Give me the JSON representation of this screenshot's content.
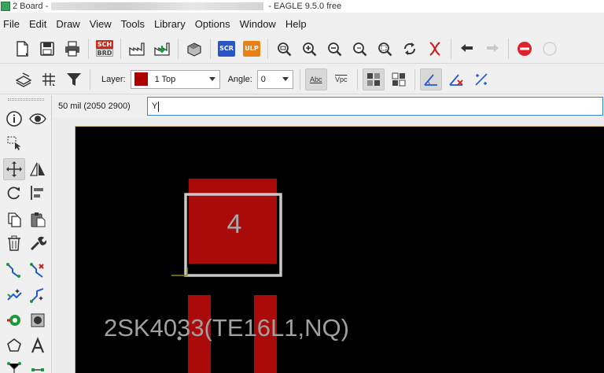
{
  "window": {
    "title_prefix": "2 Board - ",
    "title_suffix": "- EAGLE 9.5.0 free"
  },
  "menu": [
    "File",
    "Edit",
    "Draw",
    "View",
    "Tools",
    "Library",
    "Options",
    "Window",
    "Help"
  ],
  "toolbar1": {
    "sch_label": "SCH",
    "brd_label": "BRD",
    "scr_label": "SCR",
    "ulp_label": "ULP"
  },
  "toolbar2": {
    "layer_label": "Layer:",
    "layer_value": "1 Top",
    "layer_color": "#aa0000",
    "angle_label": "Angle:",
    "angle_value": "0",
    "abc_label": "Abc",
    "vpc_label": "Vpc"
  },
  "command": {
    "coordinates": "50 mil (2050 2900)",
    "input_value": "Y"
  },
  "canvas": {
    "pad_number": "4",
    "part_label": "2SK4033(TE16L1,NQ)",
    "pad_color": "#aa0a0a",
    "label_color": "#a0a0a0",
    "outline_color": "#c8c8c8",
    "board_edge_color": "#c9b06a"
  }
}
